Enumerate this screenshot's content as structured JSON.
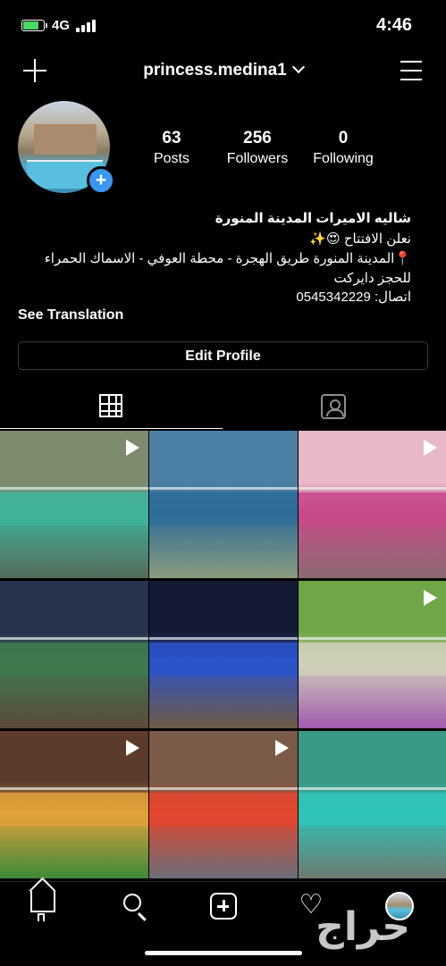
{
  "status_bar": {
    "network": "4G",
    "time": "4:46"
  },
  "header": {
    "username": "princess.medina1"
  },
  "profile": {
    "stats": [
      {
        "count": "63",
        "label": "Posts"
      },
      {
        "count": "256",
        "label": "Followers"
      },
      {
        "count": "0",
        "label": "Following"
      }
    ],
    "bio": {
      "name": "شاليه الاميرات المدينة المنورة",
      "line1": "نعلن الافتتاح 😍✨",
      "line2": "📍المدينة المنورة طريق الهجرة - محطة العوفي - الاسماك الحمراء",
      "line3": "للحجز دايركت",
      "line4": "اتصال: 0545342229"
    },
    "see_translation": "See Translation",
    "edit_profile": "Edit Profile"
  },
  "tabs": {
    "active": "grid",
    "items": [
      "grid",
      "tagged"
    ]
  },
  "grid_items": [
    {
      "type": "video",
      "colors": [
        "#7d8a6e",
        "#3fb39a",
        "#566b5b"
      ]
    },
    {
      "type": "photo",
      "colors": [
        "#4b7fa3",
        "#2f6d99",
        "#8a9a7c"
      ]
    },
    {
      "type": "video",
      "colors": [
        "#e8b8c8",
        "#c94a8a",
        "#8b6a72"
      ]
    },
    {
      "type": "photo",
      "colors": [
        "#25334d",
        "#3e7a4f",
        "#5b4a3b"
      ]
    },
    {
      "type": "photo",
      "colors": [
        "#141a33",
        "#2c52c9",
        "#6e5a45"
      ]
    },
    {
      "type": "video",
      "colors": [
        "#6fa646",
        "#cfcfb8",
        "#a35ab0"
      ]
    },
    {
      "type": "video",
      "colors": [
        "#5a3b2c",
        "#e0a13a",
        "#3d8a3a"
      ]
    },
    {
      "type": "video",
      "colors": [
        "#7a5a48",
        "#e2462f",
        "#6b6e78"
      ]
    },
    {
      "type": "photo",
      "colors": [
        "#3a9a86",
        "#2fc4b8",
        "#6d7a70"
      ]
    }
  ],
  "bottom_nav": [
    "home-icon",
    "search-icon",
    "new-post-icon",
    "activity-icon",
    "profile-avatar"
  ],
  "watermark": "حراج"
}
